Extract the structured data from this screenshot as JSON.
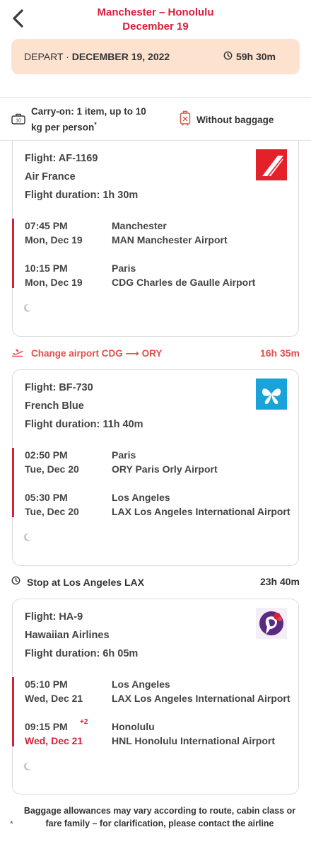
{
  "header": {
    "route": "Manchester – Honolulu",
    "date": "December 19"
  },
  "depart": {
    "label": "DEPART",
    "separator": " · ",
    "date": "DECEMBER 19, 2022",
    "duration": "59h  30m"
  },
  "baggage": {
    "carry_on": "Carry-on: 1 item, up to 10 kg per person",
    "carry_on_mark": "*",
    "carry_icon_label": "10",
    "checked": "Without baggage"
  },
  "flights": [
    {
      "flight": "Flight: AF-1169",
      "airline": "Air France",
      "duration": "Flight duration: 1h  30m",
      "logo_color": "#e4202b",
      "dep_time": "07:45 PM",
      "dep_day": "Mon, Dec 19",
      "dep_city": "Manchester",
      "dep_airport": "MAN Manchester Airport",
      "arr_time": "10:15 PM",
      "arr_day": "Mon, Dec 19",
      "arr_city": "Paris",
      "arr_airport": "CDG Charles de Gaulle Airport"
    },
    {
      "flight": "Flight: BF-730",
      "airline": "French Blue",
      "duration": "Flight duration: 11h  40m",
      "logo_color": "#1aa3d9",
      "dep_time": "02:50 PM",
      "dep_day": "Tue, Dec 20",
      "dep_city": "Paris",
      "dep_airport": "ORY Paris Orly Airport",
      "arr_time": "05:30 PM",
      "arr_day": "Tue, Dec 20",
      "arr_city": "Los Angeles",
      "arr_airport": "LAX Los Angeles International Airport"
    },
    {
      "flight": "Flight: HA-9",
      "airline": "Hawaiian Airlines",
      "duration": "Flight duration: 6h  05m",
      "logo_color": "#5a2a82",
      "dep_time": "05:10 PM",
      "dep_day": "Wed, Dec 21",
      "dep_city": "Los Angeles",
      "dep_airport": "LAX Los Angeles International Airport",
      "arr_time": "09:15 PM",
      "arr_day": "Wed, Dec 21",
      "arr_plus": "+2",
      "arr_city": "Honolulu",
      "arr_airport": "HNL Honolulu International Airport"
    }
  ],
  "change_airport": {
    "text": "Change airport CDG ⟶ ORY",
    "duration": "16h  35m"
  },
  "stop": {
    "text": "Stop at Los Angeles LAX",
    "duration": "23h  40m"
  },
  "footnote": {
    "mark": "*",
    "text": "Baggage allowances may vary according to route, cabin class or fare family – for clarification, please contact the airline"
  },
  "colors": {
    "accent": "#d6213a",
    "depart_bg": "#fce2cf",
    "change": "#e0504a"
  }
}
